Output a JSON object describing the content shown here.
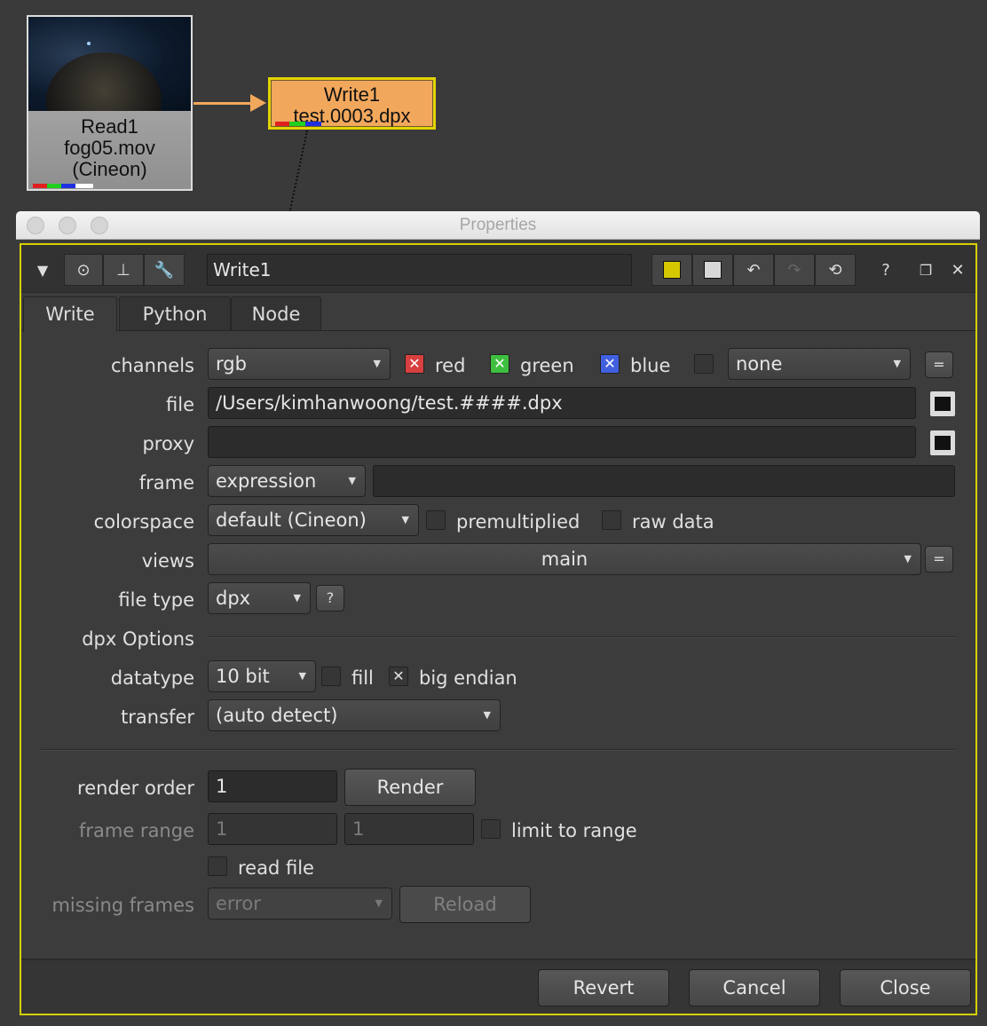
{
  "nodes": {
    "read": {
      "line1": "Read1",
      "line2": "fog05.mov",
      "line3": "(Cineon)"
    },
    "write": {
      "line1": "Write1",
      "line2": "test.0003.dpx"
    }
  },
  "window": {
    "title": "Properties"
  },
  "toolbar": {
    "node_name": "Write1",
    "help": "?"
  },
  "tabs": [
    {
      "label": "Write",
      "active": true
    },
    {
      "label": "Python",
      "active": false
    },
    {
      "label": "Node",
      "active": false
    }
  ],
  "form": {
    "channels": {
      "label": "channels",
      "value": "rgb",
      "red": "red",
      "green": "green",
      "blue": "blue",
      "extra": "none",
      "red_checked": true,
      "green_checked": true,
      "blue_checked": true
    },
    "file": {
      "label": "file",
      "value": "/Users/kimhanwoong/test.####.dpx"
    },
    "proxy": {
      "label": "proxy",
      "value": ""
    },
    "frame": {
      "label": "frame",
      "mode": "expression",
      "value": ""
    },
    "colorspace": {
      "label": "colorspace",
      "value": "default (Cineon)",
      "premultiplied": "premultiplied",
      "raw_data": "raw data"
    },
    "views": {
      "label": "views",
      "value": "main"
    },
    "file_type": {
      "label": "file type",
      "value": "dpx",
      "help": "?"
    },
    "dpx_options": {
      "label": "dpx Options"
    },
    "datatype": {
      "label": "datatype",
      "value": "10 bit",
      "fill": "fill",
      "big_endian": "big endian",
      "big_endian_checked": true
    },
    "transfer": {
      "label": "transfer",
      "value": "(auto detect)"
    },
    "render_order": {
      "label": "render order",
      "value": "1",
      "button": "Render"
    },
    "frame_range": {
      "label": "frame range",
      "start": "1",
      "end": "1",
      "limit": "limit to range"
    },
    "read_file": {
      "label": "read file"
    },
    "missing_frames": {
      "label": "missing frames",
      "value": "error",
      "button": "Reload"
    },
    "equals": "="
  },
  "footer": {
    "revert": "Revert",
    "cancel": "Cancel",
    "close": "Close"
  },
  "colors": {
    "accent_yellow": "#d6d000",
    "write_node": "#f2a85c",
    "red_check": "#d84040",
    "green_check": "#3fbf3f",
    "blue_check": "#4060e0"
  }
}
